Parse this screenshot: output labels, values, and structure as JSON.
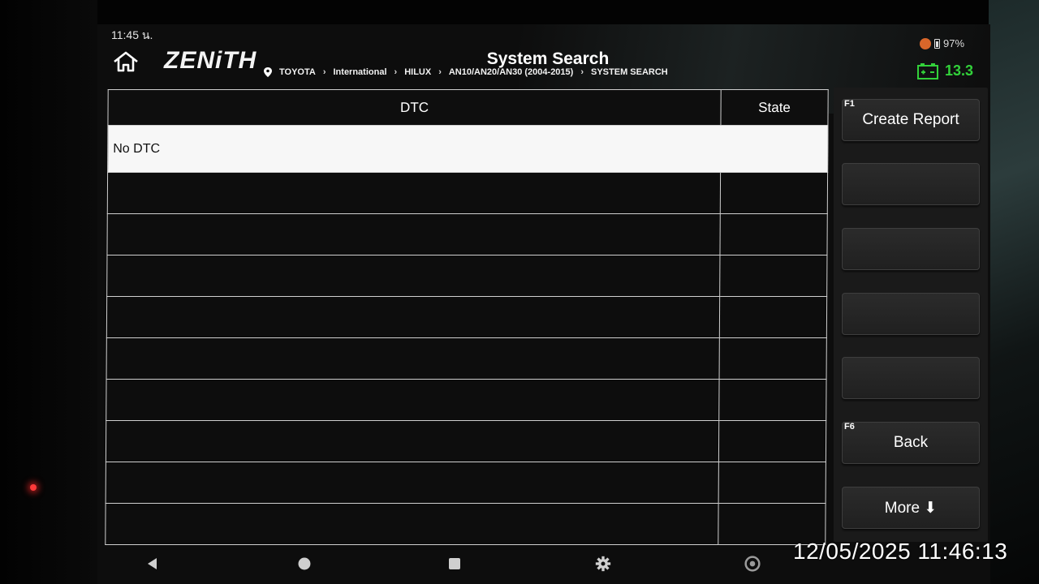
{
  "status_bar": {
    "time": "11:45 น.",
    "battery": "97%"
  },
  "header": {
    "logo": "ZENiTH",
    "title": "System Search",
    "breadcrumb": [
      "TOYOTA",
      "International",
      "HILUX",
      "AN10/AN20/AN30 (2004-2015)",
      "SYSTEM SEARCH"
    ],
    "voltage": "13.3"
  },
  "table": {
    "columns": [
      "DTC",
      "State"
    ],
    "rows": [
      {
        "dtc": "No DTC",
        "state": ""
      },
      {
        "dtc": "",
        "state": ""
      },
      {
        "dtc": "",
        "state": ""
      },
      {
        "dtc": "",
        "state": ""
      },
      {
        "dtc": "",
        "state": ""
      },
      {
        "dtc": "",
        "state": ""
      },
      {
        "dtc": "",
        "state": ""
      },
      {
        "dtc": "",
        "state": ""
      },
      {
        "dtc": "",
        "state": ""
      },
      {
        "dtc": "",
        "state": ""
      }
    ]
  },
  "function_buttons": [
    {
      "key": "F1",
      "label": "Create Report"
    },
    {
      "key": "",
      "label": ""
    },
    {
      "key": "",
      "label": ""
    },
    {
      "key": "",
      "label": ""
    },
    {
      "key": "",
      "label": ""
    },
    {
      "key": "F6",
      "label": "Back"
    },
    {
      "key": "",
      "label": "More ⬇"
    }
  ],
  "overlay": {
    "timestamp": "12/05/2025 11:46:13"
  },
  "colors": {
    "voltage_green": "#32d13a",
    "alert_orange": "#d9662a",
    "selected_row": "#f7f7f7"
  },
  "icons": [
    "home-icon",
    "location-pin-icon",
    "battery-icon",
    "car-battery-icon",
    "back-icon",
    "home-circle-icon",
    "recents-icon",
    "settings-gear-icon",
    "chrome-icon"
  ]
}
